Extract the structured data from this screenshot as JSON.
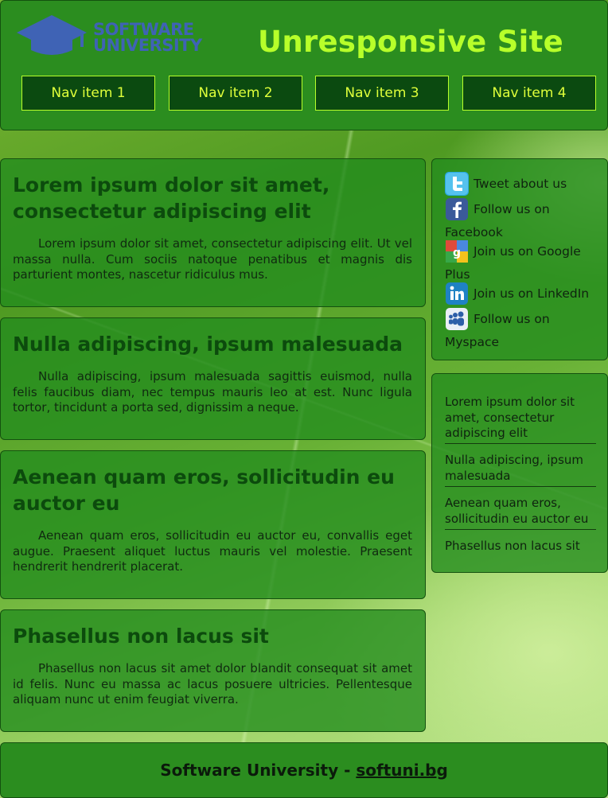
{
  "header": {
    "logo_line1": "SOFTWARE",
    "logo_line2": "UNIVERSITY",
    "title": "Unresponsive Site",
    "nav": [
      "Nav item 1",
      "Nav item 2",
      "Nav item 3",
      "Nav item 4"
    ]
  },
  "articles": [
    {
      "title": "Lorem ipsum dolor sit amet, consectetur adipiscing elit",
      "body": "Lorem ipsum dolor sit amet, consectetur adipiscing elit. Ut vel massa nulla. Cum sociis natoque penatibus et magnis dis parturient montes, nascetur ridiculus mus."
    },
    {
      "title": "Nulla adipiscing, ipsum malesuada",
      "body": "Nulla adipiscing, ipsum malesuada sagittis euismod, nulla felis faucibus diam, nec tempus mauris leo at est. Nunc ligula tortor, tincidunt a porta sed, dignissim a neque."
    },
    {
      "title": "Aenean quam eros, sollicitudin eu auctor eu",
      "body": "Aenean quam eros, sollicitudin eu auctor eu, convallis eget augue. Praesent aliquet luctus mauris vel molestie. Praesent hendrerit hendrerit placerat."
    },
    {
      "title": "Phasellus non lacus sit",
      "body": "Phasellus non lacus sit amet dolor blandit consequat sit amet id felis. Nunc eu massa ac lacus posuere ultricies. Pellentesque aliquam nunc ut enim feugiat viverra."
    }
  ],
  "social": [
    {
      "icon": "twitter-icon",
      "label": "Tweet about us"
    },
    {
      "icon": "facebook-icon",
      "label": "Follow us on",
      "label_cont": "Facebook"
    },
    {
      "icon": "google-plus-icon",
      "label": "Join us on Google",
      "label_cont": "Plus"
    },
    {
      "icon": "linkedin-icon",
      "label": "Join us on LinkedIn"
    },
    {
      "icon": "myspace-icon",
      "label": "Follow us on",
      "label_cont": "Myspace"
    }
  ],
  "article_links": [
    "Lorem ipsum dolor sit amet, consectetur adipiscing elit",
    "Nulla adipiscing, ipsum malesuada",
    "Aenean quam eros, sollicitudin eu auctor eu",
    "Phasellus non lacus sit"
  ],
  "footer": {
    "prefix": "Software University - ",
    "link": "softuni.bg"
  },
  "colors": {
    "title": "#b7ff2a",
    "nav_bg": "#0b4a10",
    "panel": "#2b8d1f",
    "heading": "#0c4b0d",
    "logo": "#3f63b5"
  }
}
